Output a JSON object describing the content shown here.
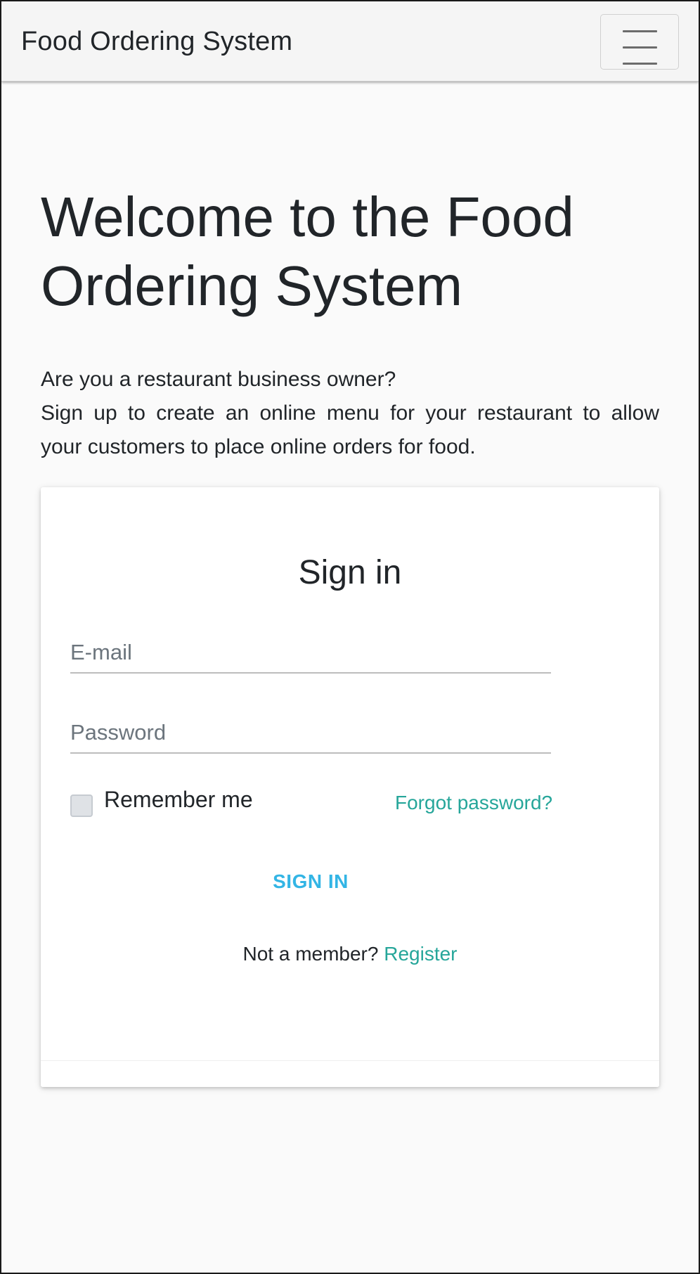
{
  "navbar": {
    "brand": "Food Ordering System",
    "toggler_icon": "hamburger-menu-icon"
  },
  "hero": {
    "title": "Welcome to the Food Ordering System",
    "question": "Are you a restaurant business owner?",
    "line2": "Sign up to create an online menu for your restaurant to allow",
    "line3": "your customers to place online orders for food."
  },
  "signin": {
    "title": "Sign in",
    "email_placeholder": "E-mail",
    "password_placeholder": "Password",
    "remember_label": "Remember me",
    "remember_checked": false,
    "forgot_label": "Forgot password?",
    "button_label": "SIGN IN",
    "member_text": "Not a member?",
    "register_label": "Register"
  },
  "colors": {
    "link": "#26a69a",
    "button": "#33b5e5",
    "text": "#212529",
    "navbar_bg": "#f5f5f5",
    "page_bg": "#fafafa"
  }
}
